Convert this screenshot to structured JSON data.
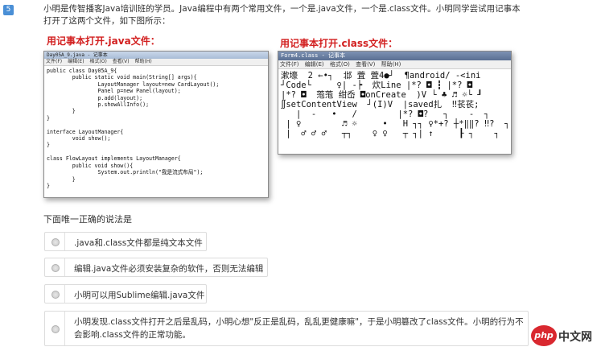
{
  "question": {
    "number": "5",
    "text": "小明是传智播客Java培训班的学员。Java编程中有两个常用文件，一个是.java文件，一个是.class文件。小明同学尝试用记事本打开了这两个文件，如下图所示："
  },
  "captions": {
    "java": "用记事本打开.java文件：",
    "class": "用记事本打开.class文件："
  },
  "java_window": {
    "title": "Day05A_9.java - 记事本",
    "menu": [
      "文件(F)",
      "编辑(E)",
      "格式(O)",
      "查看(V)",
      "帮助(H)"
    ],
    "code": "public class Day05A_9{\n        public static void main(String[] args){\n                LayoutManager layout=new CardLayout();\n                Panel p=new Panel(layout);\n                p.add(layout);\n                p.showAllInfo();\n        }\n}\n\ninterface LayoutManager{\n        void show();\n}\n\nclass FlowLayout implements LayoutManager{\n        public void show(){\n                System.out.println(\"我是流式布局\");\n        }\n}"
  },
  "class_window": {
    "title": "Form4.class - 记事本",
    "menu": [
      "文件(F)",
      "编辑(E)",
      "格式(O)",
      "查看(V)",
      "帮助(H)"
    ],
    "content": "漱壕  2 ←•┐  邶 萓 萓4●┘  ¶android/ -<ini\n┘Code└     ♀| -┝  炊Line |*? ◘ ┇ |*? ◘\n|*? ◘  萢萢 绀岙 ◘onCreate  )V └ ♣ ♬ ☼└ ┚\n∬setContentView  ┘(I)V  ∣saved扎  ‼苌苌;\n   |  -   •   /        |*? ◘?   ┐    -  ┐\n | ♀        ♬ ☼     •   H ┐┐ ♀*+? ┼*‖‖? ‼?  ┐\n |  ♂ ♂ ♂   ┬┐    ♀ ♀   ┬ ┐| ↑     ┠ ┐    ┐"
  },
  "prompt": "下面唯一正确的说法是",
  "options": [
    ".java和.class文件都是纯文本文件",
    "编辑.java文件必须安装复杂的软件，否则无法编辑",
    "小明可以用Sublime编辑.java文件",
    "小明发现.class文件打开之后是乱码，小明心想\"反正是乱码，乱乱更健康嘛\"，于是小明篡改了class文件。小明的行为不会影响.class文件的正常功能。"
  ],
  "logo": {
    "badge": "php",
    "text": "中文网"
  },
  "colors": {
    "caption_red": "#d21f1f",
    "badge_blue": "#4a8fd6",
    "logo_red": "#d9282f"
  }
}
